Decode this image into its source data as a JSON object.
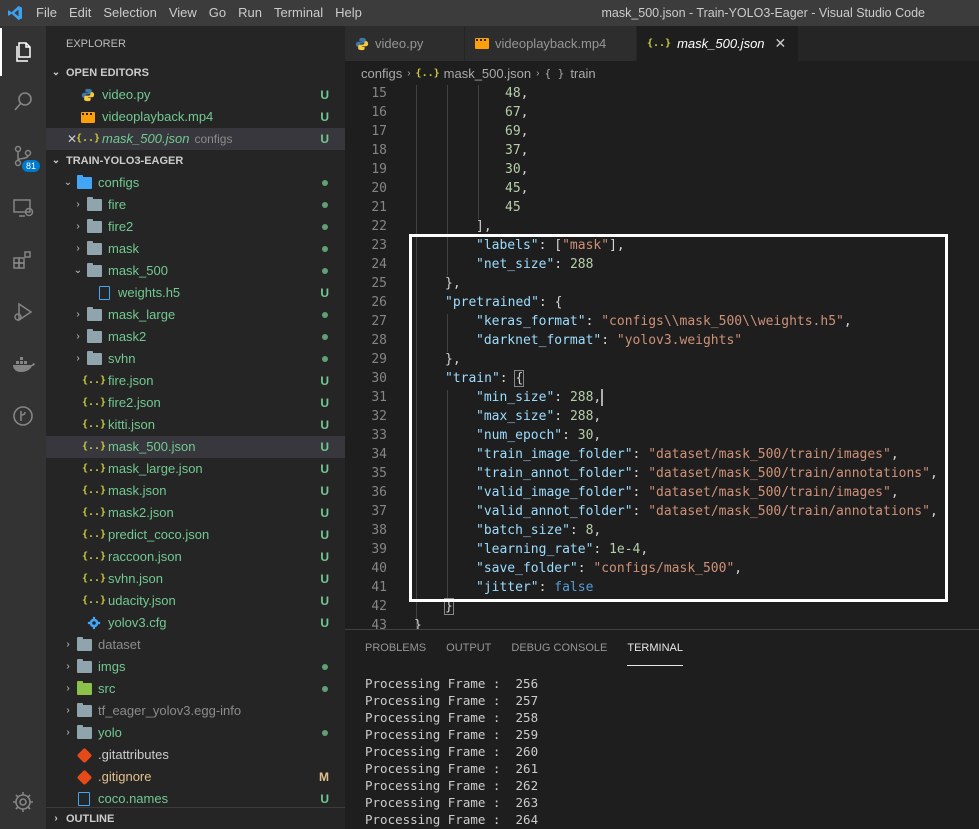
{
  "window": {
    "title": "mask_500.json - Train-YOLO3-Eager - Visual Studio Code",
    "menu": [
      "File",
      "Edit",
      "Selection",
      "View",
      "Go",
      "Run",
      "Terminal",
      "Help"
    ]
  },
  "activity_bar": {
    "items": [
      {
        "icon": "files-icon"
      },
      {
        "icon": "search-icon"
      },
      {
        "icon": "source-control-icon",
        "badge": "81"
      },
      {
        "icon": "remote-explorer-icon"
      },
      {
        "icon": "extensions-icon"
      },
      {
        "icon": "run-debug-icon"
      },
      {
        "icon": "docker-icon"
      },
      {
        "icon": "git-graph-icon"
      }
    ],
    "settings_icon": "gear-icon"
  },
  "sidebar": {
    "title": "EXPLORER",
    "open_editors": {
      "label": "OPEN EDITORS",
      "items": [
        {
          "name": "video.py",
          "status": "U"
        },
        {
          "name": "videoplayback.mp4",
          "status": "U"
        },
        {
          "name": "mask_500.json",
          "sub": "configs",
          "status": "U"
        }
      ]
    },
    "project": {
      "label": "TRAIN-YOLO3-EAGER",
      "items": [
        {
          "name": "configs"
        },
        {
          "name": "fire"
        },
        {
          "name": "fire2"
        },
        {
          "name": "mask"
        },
        {
          "name": "mask_500"
        },
        {
          "name": "weights.h5",
          "status": "U"
        },
        {
          "name": "mask_large"
        },
        {
          "name": "mask2"
        },
        {
          "name": "svhn"
        },
        {
          "name": "fire.json",
          "status": "U"
        },
        {
          "name": "fire2.json",
          "status": "U"
        },
        {
          "name": "kitti.json",
          "status": "U"
        },
        {
          "name": "mask_500.json",
          "status": "U"
        },
        {
          "name": "mask_large.json",
          "status": "U"
        },
        {
          "name": "mask.json",
          "status": "U"
        },
        {
          "name": "mask2.json",
          "status": "U"
        },
        {
          "name": "predict_coco.json",
          "status": "U"
        },
        {
          "name": "raccoon.json",
          "status": "U"
        },
        {
          "name": "svhn.json",
          "status": "U"
        },
        {
          "name": "udacity.json",
          "status": "U"
        },
        {
          "name": "yolov3.cfg",
          "status": "U"
        },
        {
          "name": "dataset"
        },
        {
          "name": "imgs"
        },
        {
          "name": "src"
        },
        {
          "name": "tf_eager_yolov3.egg-info"
        },
        {
          "name": "yolo"
        },
        {
          "name": ".gitattributes"
        },
        {
          "name": ".gitignore",
          "status": "M"
        },
        {
          "name": "coco.names",
          "status": "U"
        }
      ]
    },
    "outline_label": "OUTLINE"
  },
  "editor": {
    "tabs": [
      {
        "label": "video.py"
      },
      {
        "label": "videoplayback.mp4"
      },
      {
        "label": "mask_500.json",
        "active": true,
        "close": "✕"
      }
    ],
    "breadcrumb": {
      "folder": "configs",
      "file": "mask_500.json",
      "symbol": "train",
      "braces": "{ }"
    },
    "lines": [
      {
        "num": "15",
        "parts": [
          [
            "n",
            "48"
          ],
          [
            "p",
            ","
          ]
        ]
      },
      {
        "num": "16",
        "parts": [
          [
            "n",
            "67"
          ],
          [
            "p",
            ","
          ]
        ]
      },
      {
        "num": "17",
        "parts": [
          [
            "n",
            "69"
          ],
          [
            "p",
            ","
          ]
        ]
      },
      {
        "num": "18",
        "parts": [
          [
            "n",
            "37"
          ],
          [
            "p",
            ","
          ]
        ]
      },
      {
        "num": "19",
        "parts": [
          [
            "n",
            "30"
          ],
          [
            "p",
            ","
          ]
        ]
      },
      {
        "num": "20",
        "parts": [
          [
            "n",
            "45"
          ],
          [
            "p",
            ","
          ]
        ]
      },
      {
        "num": "21",
        "parts": [
          [
            "n",
            "45"
          ]
        ]
      },
      {
        "num": "22",
        "parts": [
          [
            "p",
            "],"
          ]
        ]
      },
      {
        "num": "23",
        "parts": [
          [
            "k",
            "\"labels\""
          ],
          [
            "p",
            ": ["
          ],
          [
            "s",
            "\"mask\""
          ],
          [
            "p",
            "],"
          ]
        ]
      },
      {
        "num": "24",
        "parts": [
          [
            "k",
            "\"net_size\""
          ],
          [
            "p",
            ": "
          ],
          [
            "n",
            "288"
          ]
        ]
      },
      {
        "num": "25",
        "parts": [
          [
            "p",
            "},"
          ]
        ]
      },
      {
        "num": "26",
        "parts": [
          [
            "k",
            "\"pretrained\""
          ],
          [
            "p",
            ": {"
          ]
        ]
      },
      {
        "num": "27",
        "parts": [
          [
            "k",
            "\"keras_format\""
          ],
          [
            "p",
            ": "
          ],
          [
            "s",
            "\"configs\\\\mask_500\\\\weights.h5\""
          ],
          [
            "p",
            ","
          ]
        ]
      },
      {
        "num": "28",
        "parts": [
          [
            "k",
            "\"darknet_format\""
          ],
          [
            "p",
            ": "
          ],
          [
            "s",
            "\"yolov3.weights\""
          ]
        ]
      },
      {
        "num": "29",
        "parts": [
          [
            "p",
            "},"
          ]
        ]
      },
      {
        "num": "30",
        "parts": [
          [
            "k",
            "\"train\""
          ],
          [
            "p",
            ": "
          ],
          [
            "box",
            "{"
          ]
        ]
      },
      {
        "num": "31",
        "parts": [
          [
            "k",
            "\"min_size\""
          ],
          [
            "p",
            ": "
          ],
          [
            "n",
            "288"
          ],
          [
            "p",
            ","
          ],
          [
            "cursor",
            ""
          ]
        ]
      },
      {
        "num": "32",
        "parts": [
          [
            "k",
            "\"max_size\""
          ],
          [
            "p",
            ": "
          ],
          [
            "n",
            "288"
          ],
          [
            "p",
            ","
          ]
        ]
      },
      {
        "num": "33",
        "parts": [
          [
            "k",
            "\"num_epoch\""
          ],
          [
            "p",
            ": "
          ],
          [
            "n",
            "30"
          ],
          [
            "p",
            ","
          ]
        ]
      },
      {
        "num": "34",
        "parts": [
          [
            "k",
            "\"train_image_folder\""
          ],
          [
            "p",
            ": "
          ],
          [
            "s",
            "\"dataset/mask_500/train/images\""
          ],
          [
            "p",
            ","
          ]
        ]
      },
      {
        "num": "35",
        "parts": [
          [
            "k",
            "\"train_annot_folder\""
          ],
          [
            "p",
            ": "
          ],
          [
            "s",
            "\"dataset/mask_500/train/annotations\""
          ],
          [
            "p",
            ","
          ]
        ]
      },
      {
        "num": "36",
        "parts": [
          [
            "k",
            "\"valid_image_folder\""
          ],
          [
            "p",
            ": "
          ],
          [
            "s",
            "\"dataset/mask_500/train/images\""
          ],
          [
            "p",
            ","
          ]
        ]
      },
      {
        "num": "37",
        "parts": [
          [
            "k",
            "\"valid_annot_folder\""
          ],
          [
            "p",
            ": "
          ],
          [
            "s",
            "\"dataset/mask_500/train/annotations\""
          ],
          [
            "p",
            ","
          ]
        ]
      },
      {
        "num": "38",
        "parts": [
          [
            "k",
            "\"batch_size\""
          ],
          [
            "p",
            ": "
          ],
          [
            "n",
            "8"
          ],
          [
            "p",
            ","
          ]
        ]
      },
      {
        "num": "39",
        "parts": [
          [
            "k",
            "\"learning_rate\""
          ],
          [
            "p",
            ": "
          ],
          [
            "n",
            "1e-4"
          ],
          [
            "p",
            ","
          ]
        ]
      },
      {
        "num": "40",
        "parts": [
          [
            "k",
            "\"save_folder\""
          ],
          [
            "p",
            ": "
          ],
          [
            "s",
            "\"configs/mask_500\""
          ],
          [
            "p",
            ","
          ]
        ]
      },
      {
        "num": "41",
        "parts": [
          [
            "k",
            "\"jitter\""
          ],
          [
            "p",
            ": "
          ],
          [
            "b",
            "false"
          ]
        ]
      },
      {
        "num": "42",
        "parts": [
          [
            "box",
            "}"
          ]
        ]
      },
      {
        "num": "43",
        "parts": [
          [
            "p",
            "}"
          ]
        ]
      }
    ]
  },
  "panel": {
    "tabs": [
      "PROBLEMS",
      "OUTPUT",
      "DEBUG CONSOLE",
      "TERMINAL"
    ],
    "active_tab": "TERMINAL",
    "terminal_lines": [
      "Processing Frame :  256",
      "Processing Frame :  257",
      "Processing Frame :  258",
      "Processing Frame :  259",
      "Processing Frame :  260",
      "Processing Frame :  261",
      "Processing Frame :  262",
      "Processing Frame :  263",
      "Processing Frame :  264"
    ]
  },
  "colors": {
    "accent": "#007acc",
    "untracked": "#73c991",
    "modified": "#e2c08d",
    "json_icon": "#cbcb41"
  }
}
